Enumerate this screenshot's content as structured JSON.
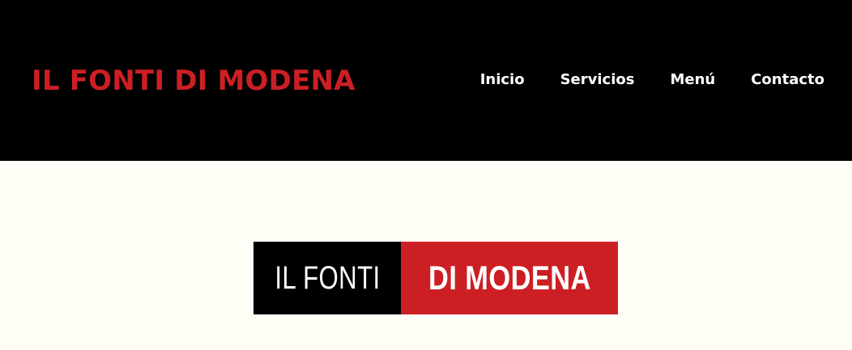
{
  "header": {
    "brand": "IL FONTI DI MODENA",
    "nav": [
      {
        "label": "Inicio"
      },
      {
        "label": "Servicios"
      },
      {
        "label": "Menú"
      },
      {
        "label": "Contacto"
      }
    ]
  },
  "main": {
    "logo": {
      "left_text": "IL FONTI",
      "right_text": "DI MODENA"
    }
  },
  "colors": {
    "brand_red": "#cc1f24",
    "header_bg": "#000000",
    "page_bg": "#fffff8",
    "nav_text": "#ffffff"
  }
}
